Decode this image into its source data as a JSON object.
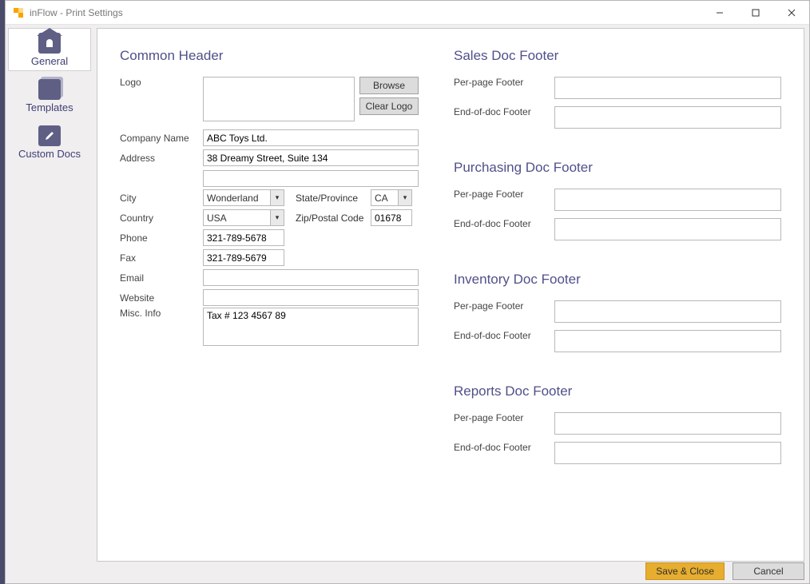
{
  "window": {
    "title": "inFlow - Print Settings",
    "min": "—",
    "max": "▢",
    "close": "✕"
  },
  "sidebar": {
    "general": "General",
    "templates": "Templates",
    "custom": "Custom Docs"
  },
  "header": {
    "section": "Common Header",
    "labels": {
      "logo": "Logo",
      "browse": "Browse",
      "clear": "Clear Logo",
      "company": "Company Name",
      "address": "Address",
      "city": "City",
      "state": "State/Province",
      "country": "Country",
      "zip": "Zip/Postal Code",
      "phone": "Phone",
      "fax": "Fax",
      "email": "Email",
      "website": "Website",
      "misc": "Misc. Info"
    },
    "values": {
      "company": "ABC Toys Ltd.",
      "address1": "38 Dreamy Street, Suite 134",
      "address2": "",
      "city": "Wonderland",
      "state": "CA",
      "country": "USA",
      "zip": "01678",
      "phone": "321-789-5678",
      "fax": "321-789-5679",
      "email": "",
      "website": "",
      "misc": "Tax # 123 4567 89"
    }
  },
  "footers": {
    "sections": {
      "sales": "Sales Doc Footer",
      "purchasing": "Purchasing Doc Footer",
      "inventory": "Inventory Doc Footer",
      "reports": "Reports Doc Footer"
    },
    "labels": {
      "perpage": "Per-page Footer",
      "enddoc": "End-of-doc Footer"
    },
    "values": {
      "sales_per": "",
      "sales_end": "",
      "purch_per": "",
      "purch_end": "",
      "inv_per": "",
      "inv_end": "",
      "rep_per": "",
      "rep_end": ""
    }
  },
  "buttons": {
    "save": "Save & Close",
    "cancel": "Cancel"
  }
}
